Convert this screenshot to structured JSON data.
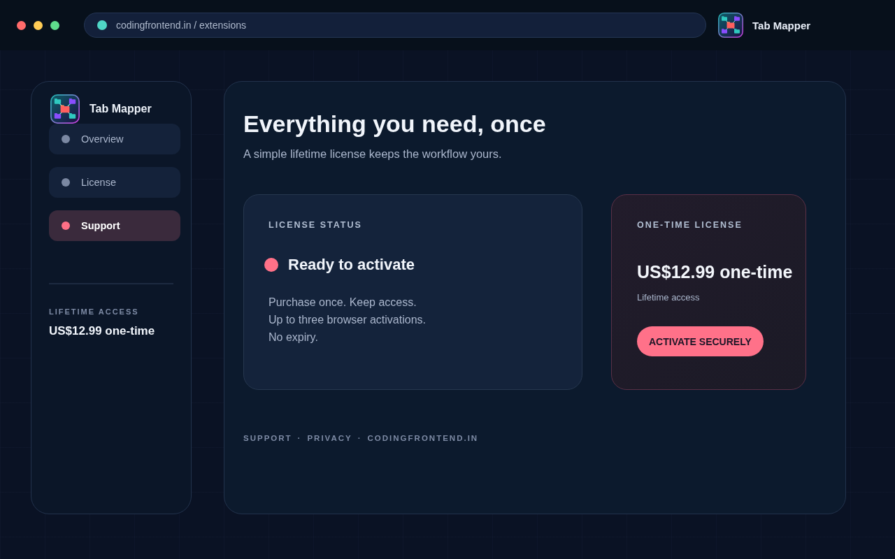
{
  "window_controls": [
    {
      "color": "#ff6b6b"
    },
    {
      "color": "#ffcc55"
    },
    {
      "color": "#5fdc8c"
    }
  ],
  "address_bar": {
    "value": "codingfrontend.in / extensions"
  },
  "app": {
    "title": "Tab Mapper"
  },
  "sidebar": {
    "title": "Tab Mapper",
    "items": [
      {
        "label": "Overview",
        "selected": false
      },
      {
        "label": "License",
        "selected": false
      },
      {
        "label": "Support",
        "selected": true
      }
    ],
    "price_label": "LIFETIME ACCESS",
    "price": "US$12.99 one-time"
  },
  "main": {
    "heading": "Everything you need, once",
    "subtitle": "A simple lifetime license keeps the workflow yours.",
    "status_card": {
      "label": "LICENSE STATUS",
      "status": "Ready to activate",
      "lines": [
        "Purchase once. Keep access.",
        "Up to three browser activations.",
        "No expiry."
      ]
    },
    "license_card": {
      "label": "ONE-TIME LICENSE",
      "price": "US$12.99 one-time",
      "note": "Lifetime access",
      "button": "ACTIVATE SECURELY"
    },
    "footer": [
      {
        "text": "SUPPORT",
        "separator": "·"
      },
      {
        "text": "PRIVACY",
        "separator": "·"
      },
      {
        "text": "CODINGFRONTEND.IN"
      }
    ]
  }
}
